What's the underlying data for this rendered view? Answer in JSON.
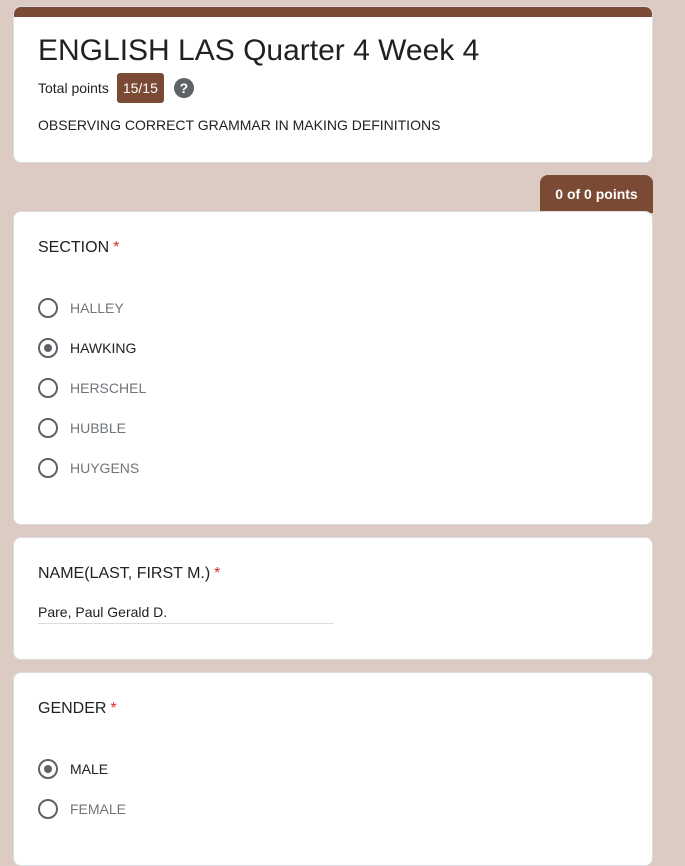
{
  "header": {
    "title": "ENGLISH LAS Quarter 4 Week 4",
    "points_label": "Total points",
    "score": "15/15",
    "help_symbol": "?",
    "description": "OBSERVING CORRECT GRAMMAR IN MAKING DEFINITIONS"
  },
  "section_points": "0 of 0 points",
  "required_mark": "*",
  "questions": [
    {
      "title": "SECTION",
      "options": [
        "HALLEY",
        "HAWKING",
        "HERSCHEL",
        "HUBBLE",
        "HUYGENS"
      ],
      "selected": "HAWKING"
    },
    {
      "title": "NAME(LAST, FIRST M.)",
      "answer": "Pare, Paul Gerald D."
    },
    {
      "title": "GENDER",
      "options": [
        "MALE",
        "FEMALE"
      ],
      "selected": "MALE"
    }
  ],
  "colors": {
    "background": "#dccbc3",
    "accent": "#7a4a35",
    "required": "#d93025"
  }
}
